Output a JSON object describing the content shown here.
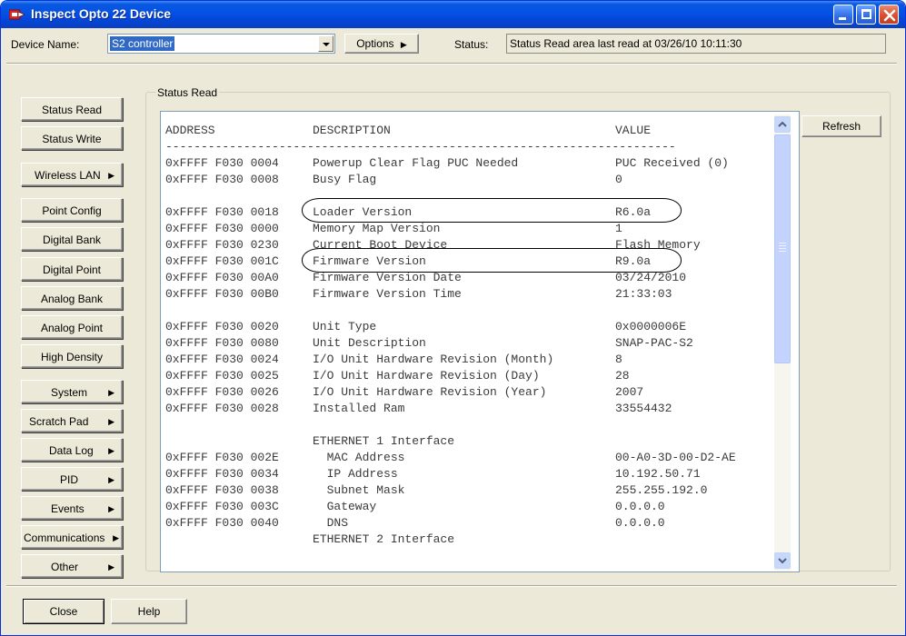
{
  "window": {
    "title": "Inspect Opto 22 Device"
  },
  "device": {
    "label": "Device Name:",
    "value": "S2 controller"
  },
  "options_button": "Options",
  "status": {
    "label": "Status:",
    "text": "Status Read area last read at 03/26/10 10:11:30"
  },
  "sidebar": {
    "items": [
      {
        "label": "Status Read",
        "submenu": false
      },
      {
        "label": "Status Write",
        "submenu": false
      },
      {
        "label": "Wireless LAN",
        "submenu": true
      },
      {
        "label": "Point Config",
        "submenu": false
      },
      {
        "label": "Digital Bank",
        "submenu": false
      },
      {
        "label": "Digital Point",
        "submenu": false
      },
      {
        "label": "Analog Bank",
        "submenu": false
      },
      {
        "label": "Analog Point",
        "submenu": false
      },
      {
        "label": "High Density",
        "submenu": false
      },
      {
        "label": "System",
        "submenu": true
      },
      {
        "label": "Scratch Pad",
        "submenu": true
      },
      {
        "label": "Data Log",
        "submenu": true
      },
      {
        "label": "PID",
        "submenu": true
      },
      {
        "label": "Events",
        "submenu": true
      },
      {
        "label": "Communications",
        "submenu": true
      },
      {
        "label": "Other",
        "submenu": true
      }
    ]
  },
  "group": {
    "title": "Status Read"
  },
  "table": {
    "headers": {
      "address": "ADDRESS",
      "description": "DESCRIPTION",
      "value": "VALUE"
    },
    "separator": "------------------------------------------------------------------------",
    "rows": [
      {
        "address": "0xFFFF F030 0004",
        "description": "Powerup Clear Flag PUC Needed",
        "value": "PUC Received (0)"
      },
      {
        "address": "0xFFFF F030 0008",
        "description": "Busy Flag",
        "value": "0"
      },
      {
        "address": "",
        "description": "",
        "value": ""
      },
      {
        "address": "0xFFFF F030 0018",
        "description": "Loader Version",
        "value": "R6.0a"
      },
      {
        "address": "0xFFFF F030 0000",
        "description": "Memory Map Version",
        "value": "1"
      },
      {
        "address": "0xFFFF F030 0230",
        "description": "Current Boot Device",
        "value": "Flash Memory"
      },
      {
        "address": "0xFFFF F030 001C",
        "description": "Firmware Version",
        "value": "R9.0a"
      },
      {
        "address": "0xFFFF F030 00A0",
        "description": "Firmware Version Date",
        "value": "03/24/2010"
      },
      {
        "address": "0xFFFF F030 00B0",
        "description": "Firmware Version Time",
        "value": "21:33:03"
      },
      {
        "address": "",
        "description": "",
        "value": ""
      },
      {
        "address": "0xFFFF F030 0020",
        "description": "Unit Type",
        "value": "0x0000006E"
      },
      {
        "address": "0xFFFF F030 0080",
        "description": "Unit Description",
        "value": "SNAP-PAC-S2"
      },
      {
        "address": "0xFFFF F030 0024",
        "description": "I/O Unit Hardware Revision (Month)",
        "value": "8"
      },
      {
        "address": "0xFFFF F030 0025",
        "description": "I/O Unit Hardware Revision (Day)",
        "value": "28"
      },
      {
        "address": "0xFFFF F030 0026",
        "description": "I/O Unit Hardware Revision (Year)",
        "value": "2007"
      },
      {
        "address": "0xFFFF F030 0028",
        "description": "Installed Ram",
        "value": "33554432"
      },
      {
        "address": "",
        "description": "",
        "value": ""
      },
      {
        "address": "",
        "description": "ETHERNET 1 Interface",
        "value": ""
      },
      {
        "address": "0xFFFF F030 002E",
        "description": "  MAC Address",
        "value": "00-A0-3D-00-D2-AE"
      },
      {
        "address": "0xFFFF F030 0034",
        "description": "  IP Address",
        "value": "10.192.50.71"
      },
      {
        "address": "0xFFFF F030 0038",
        "description": "  Subnet Mask",
        "value": "255.255.192.0"
      },
      {
        "address": "0xFFFF F030 003C",
        "description": "  Gateway",
        "value": "0.0.0.0"
      },
      {
        "address": "0xFFFF F030 0040",
        "description": "  DNS",
        "value": "0.0.0.0"
      },
      {
        "address": "",
        "description": "ETHERNET 2 Interface",
        "value": ""
      }
    ]
  },
  "buttons": {
    "refresh": "Refresh",
    "close": "Close",
    "help": "Help"
  }
}
